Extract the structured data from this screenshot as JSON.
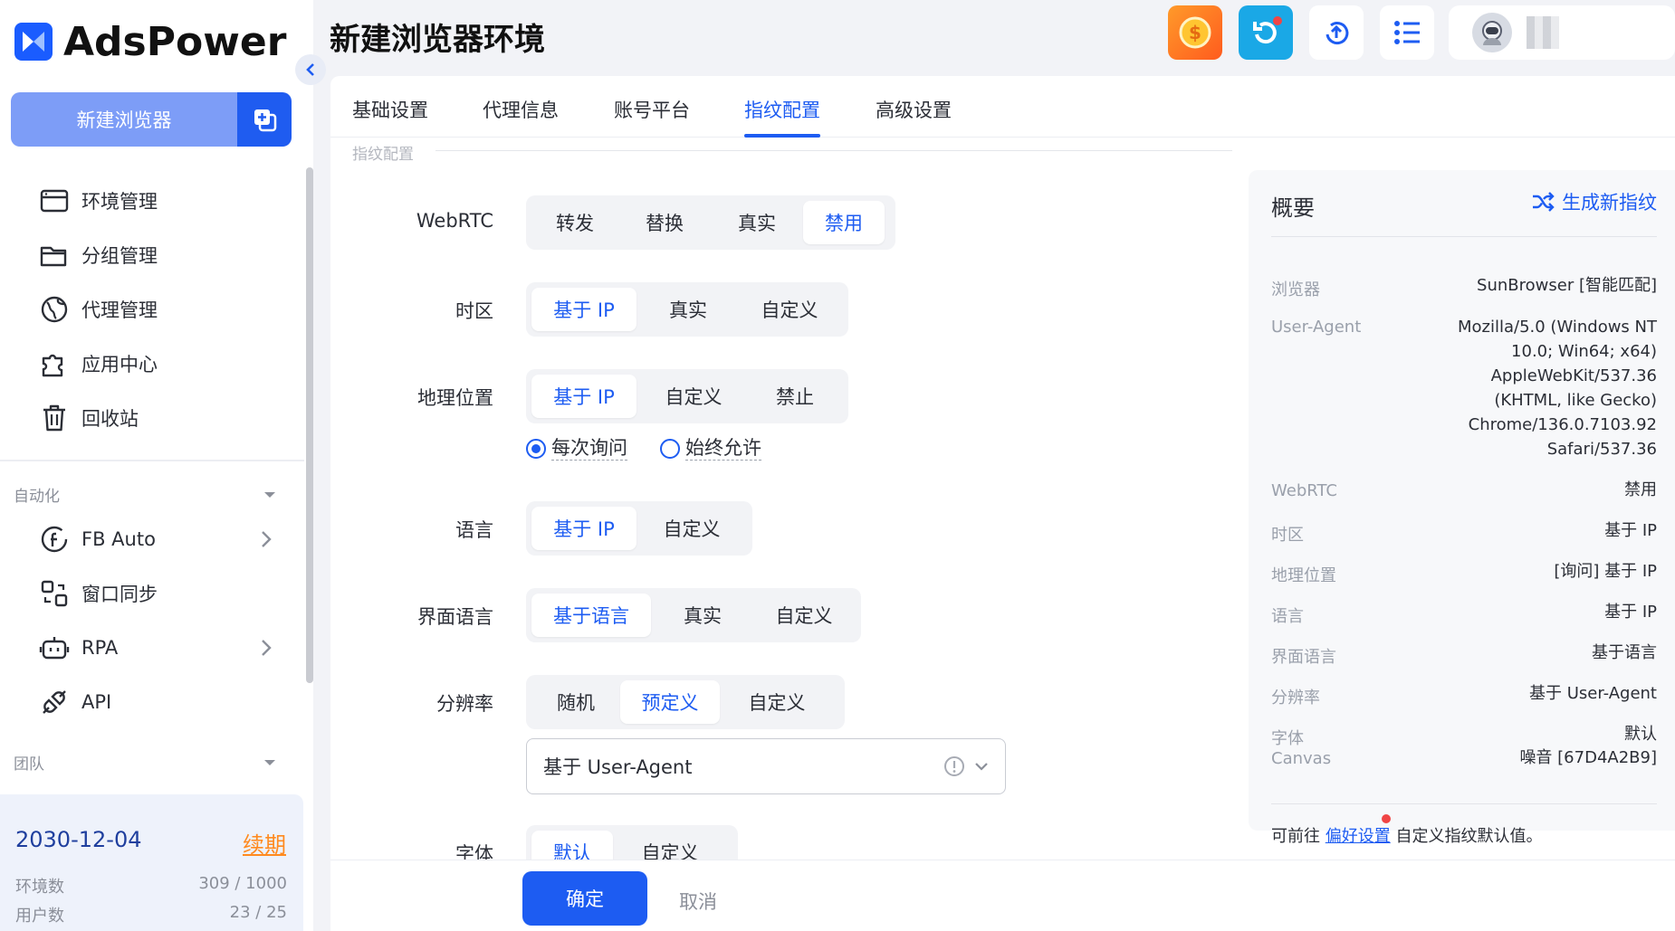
{
  "brand": {
    "name": "AdsPower"
  },
  "sidebar": {
    "new_browser_label": "新建浏览器",
    "nav": [
      {
        "label": "环境管理",
        "icon": "browser-window-icon"
      },
      {
        "label": "分组管理",
        "icon": "folder-icon"
      },
      {
        "label": "代理管理",
        "icon": "globe-proxy-icon"
      },
      {
        "label": "应用中心",
        "icon": "puzzle-icon"
      },
      {
        "label": "回收站",
        "icon": "trash-icon"
      }
    ],
    "automation": {
      "heading": "自动化",
      "items": [
        {
          "label": "FB Auto",
          "icon": "facebook-icon"
        },
        {
          "label": "窗口同步",
          "icon": "sync-windows-icon"
        },
        {
          "label": "RPA",
          "icon": "robot-icon"
        },
        {
          "label": "API",
          "icon": "plug-icon"
        }
      ]
    },
    "team_heading": "团队",
    "account": {
      "expiry_date": "2030-12-04",
      "renew_label": "续期",
      "profiles_label": "环境数",
      "profiles_value": "309 / 1000",
      "users_label": "用户数",
      "users_value": "23 / 25"
    }
  },
  "header": {
    "title": "新建浏览器环境"
  },
  "tabs": [
    {
      "label": "基础设置"
    },
    {
      "label": "代理信息"
    },
    {
      "label": "账号平台"
    },
    {
      "label": "指纹配置",
      "active": true
    },
    {
      "label": "高级设置"
    }
  ],
  "form": {
    "section_label": "指纹配置",
    "webrtc": {
      "label": "WebRTC",
      "options": [
        "转发",
        "替换",
        "真实",
        "禁用"
      ],
      "selected": "禁用"
    },
    "timezone": {
      "label": "时区",
      "options": [
        "基于 IP",
        "真实",
        "自定义"
      ],
      "selected": "基于 IP"
    },
    "geolocation": {
      "label": "地理位置",
      "options": [
        "基于 IP",
        "自定义",
        "禁止"
      ],
      "selected": "基于 IP",
      "radio_ask": "每次询问",
      "radio_allow": "始终允许",
      "radio_selected": "每次询问"
    },
    "language": {
      "label": "语言",
      "options": [
        "基于 IP",
        "自定义"
      ],
      "selected": "基于 IP"
    },
    "ui_language": {
      "label": "界面语言",
      "options": [
        "基于语言",
        "真实",
        "自定义"
      ],
      "selected": "基于语言"
    },
    "resolution": {
      "label": "分辨率",
      "options": [
        "随机",
        "预定义",
        "自定义"
      ],
      "selected": "预定义",
      "select_value": "基于 User-Agent"
    },
    "font": {
      "label": "字体",
      "options": [
        "默认",
        "自定义"
      ],
      "selected": "默认"
    }
  },
  "overview": {
    "title": "概要",
    "generate_label": "生成新指纹",
    "rows": [
      {
        "key": "浏览器",
        "value": "SunBrowser [智能匹配]"
      },
      {
        "key": "User-Agent",
        "value_lines": [
          "Mozilla/5.0 (Windows NT",
          "10.0; Win64; x64)",
          "AppleWebKit/537.36",
          "(KHTML, like Gecko)",
          "Chrome/136.0.7103.92",
          "Safari/537.36"
        ]
      },
      {
        "key": "WebRTC",
        "value": "禁用"
      },
      {
        "key": "时区",
        "value": "基于 IP"
      },
      {
        "key": "地理位置",
        "value": "[询问] 基于 IP"
      },
      {
        "key": "语言",
        "value": "基于 IP"
      },
      {
        "key": "界面语言",
        "value": "基于语言"
      },
      {
        "key": "分辨率",
        "value": "基于 User-Agent"
      },
      {
        "key": "字体",
        "value": "默认"
      },
      {
        "key": "Canvas",
        "value": "噪音 [67D4A2B9]"
      }
    ],
    "footer_prefix": "可前往",
    "footer_link": "偏好设置",
    "footer_suffix": "自定义指纹默认值。"
  },
  "actions": {
    "confirm_label": "确定",
    "cancel_label": "取消"
  },
  "colors": {
    "primary": "#1d5cf2",
    "renew": "#ff8a1f"
  }
}
